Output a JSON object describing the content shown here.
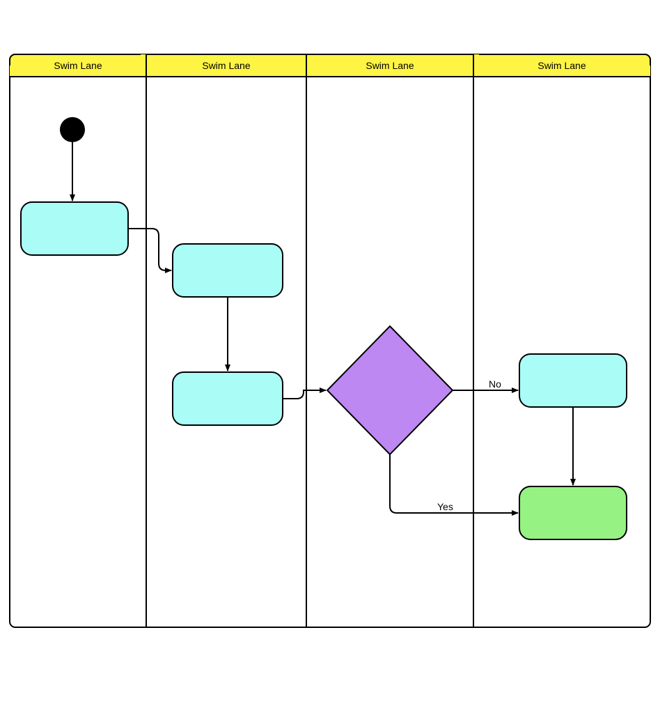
{
  "lanes": [
    {
      "label": "Swim Lane"
    },
    {
      "label": "Swim Lane"
    },
    {
      "label": "Swim Lane"
    },
    {
      "label": "Swim Lane"
    }
  ],
  "edge_labels": {
    "no": "No",
    "yes": "Yes"
  },
  "colors": {
    "lane_header": "#fef444",
    "activity_fill": "#aafdf7",
    "decision_fill": "#bd88f2",
    "terminal_fill": "#95f283",
    "stroke": "#000000"
  }
}
